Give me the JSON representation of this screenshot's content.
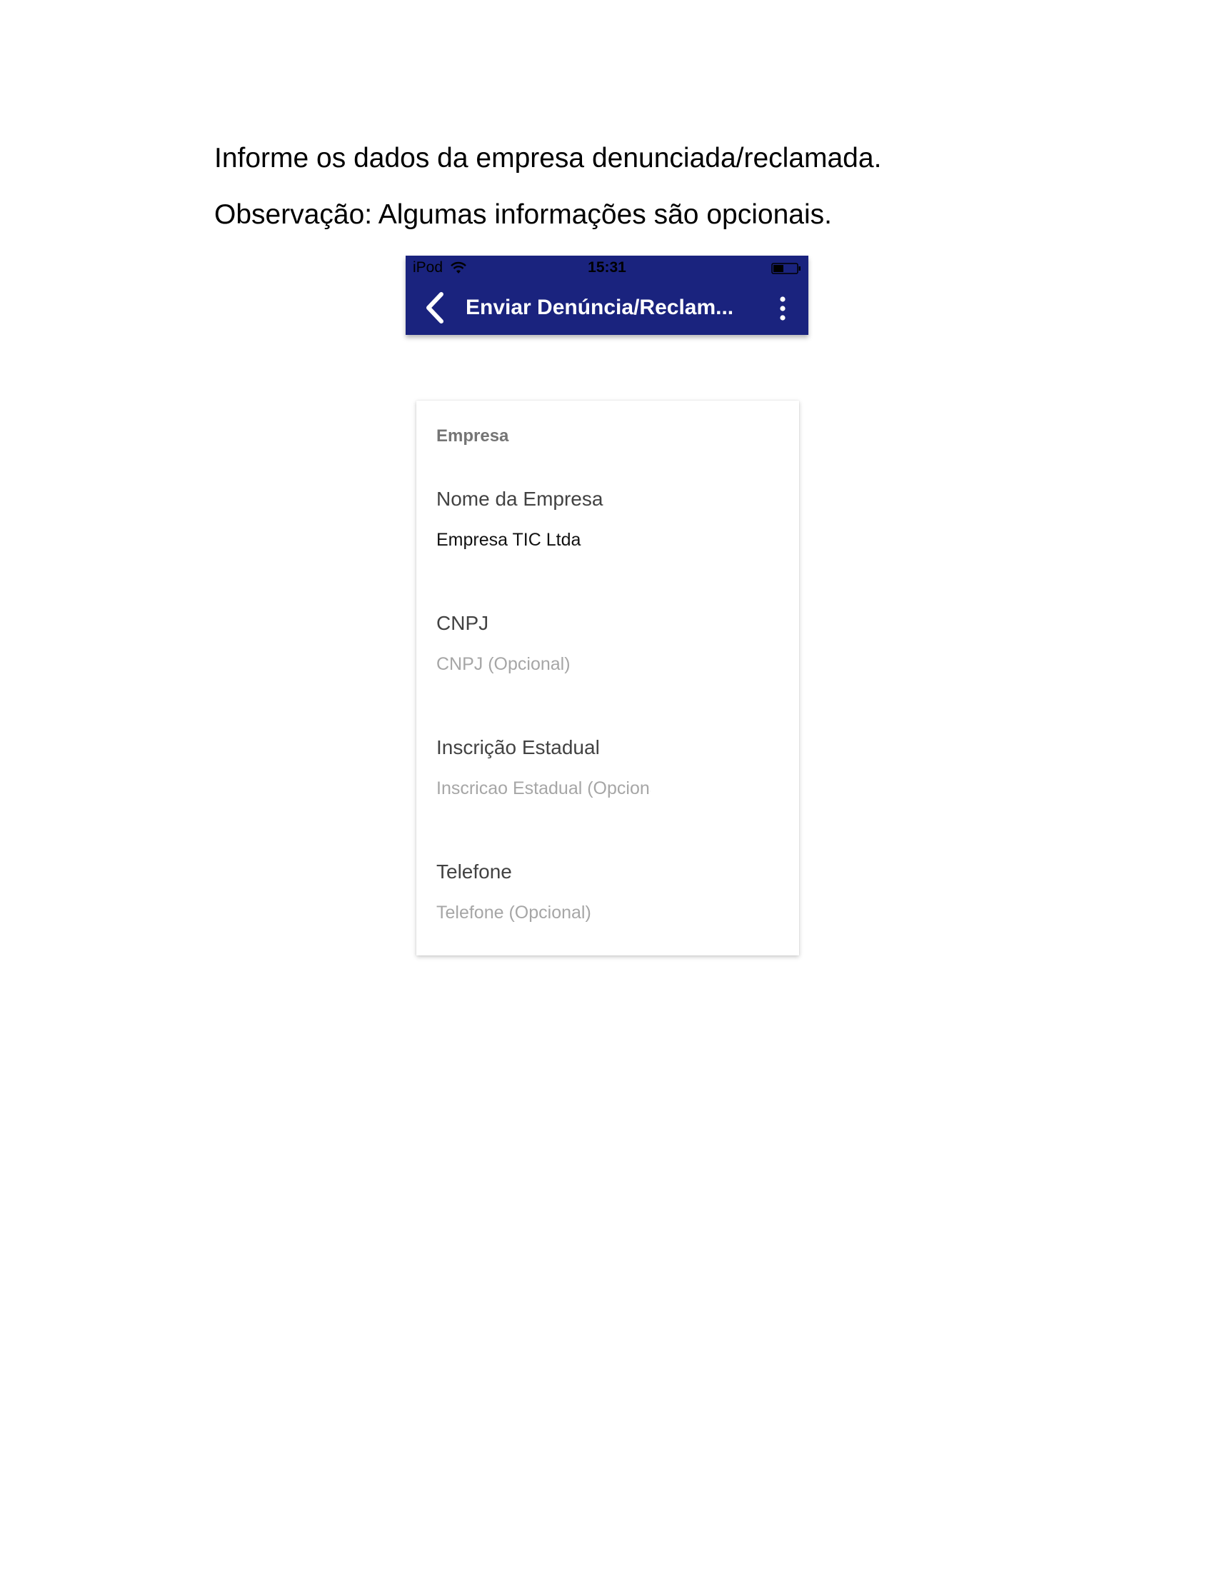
{
  "intro": {
    "line1": "Informe os dados da empresa denunciada/reclamada.",
    "line2": "Observação: Algumas informações são opcionais."
  },
  "status_bar": {
    "carrier": "iPod",
    "time": "15:31",
    "wifi_icon": "wifi-icon",
    "battery_icon": "battery-icon"
  },
  "nav_bar": {
    "title": "Enviar Denúncia/Reclam...",
    "back_icon": "chevron-left-icon",
    "menu_icon": "more-vertical-icon",
    "background_color": "#1a237e"
  },
  "card": {
    "header": "Empresa",
    "fields": [
      {
        "label": "Nome da Empresa",
        "value": "Empresa TIC Ltda",
        "placeholder": ""
      },
      {
        "label": "CNPJ",
        "value": "",
        "placeholder": "CNPJ (Opcional)"
      },
      {
        "label": "Inscrição Estadual",
        "value": "",
        "placeholder": "Inscricao Estadual (Opcional)"
      },
      {
        "label": "Telefone",
        "value": "",
        "placeholder": "Telefone (Opcional)"
      }
    ]
  }
}
